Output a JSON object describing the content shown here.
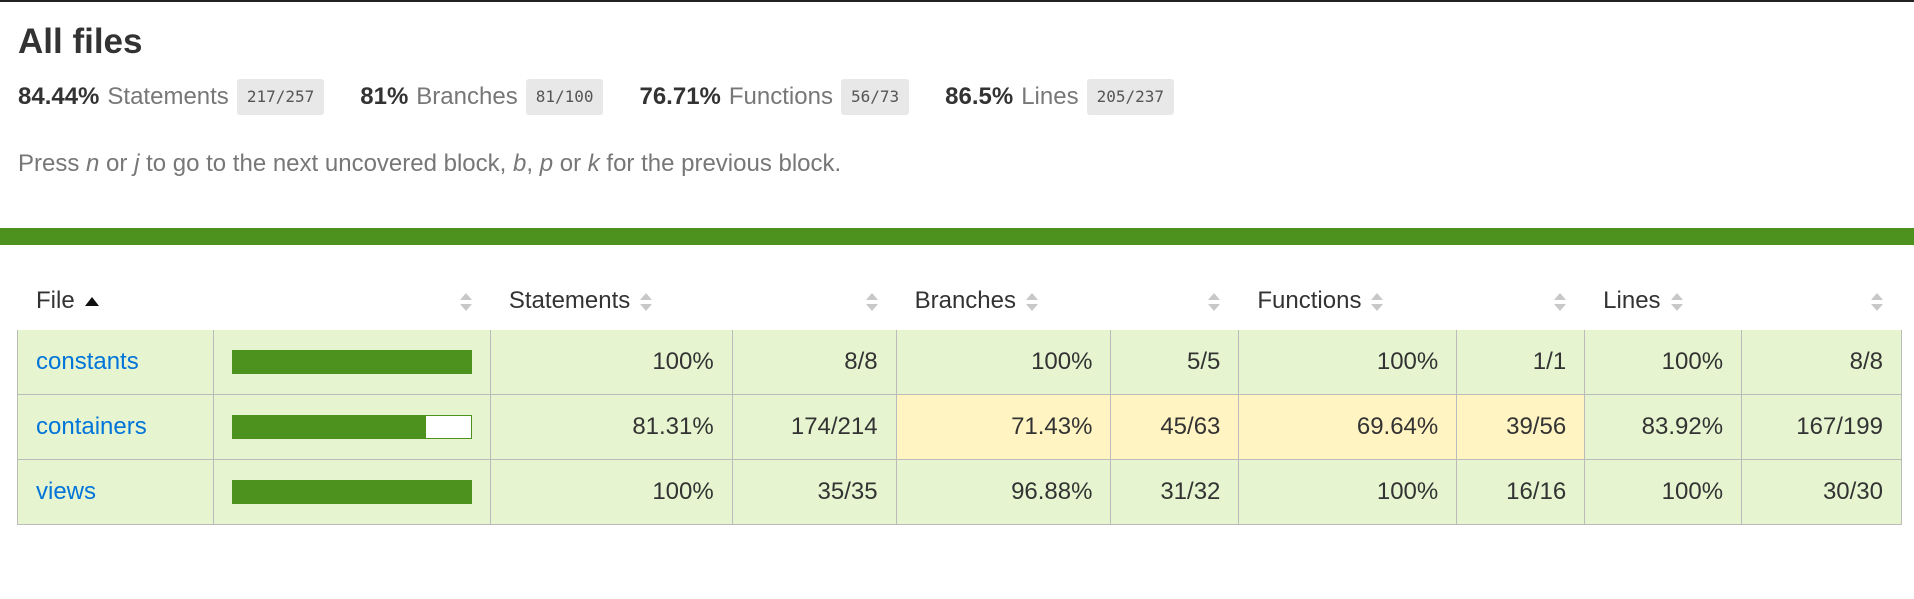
{
  "title": "All files",
  "summary": [
    {
      "pct": "84.44%",
      "label": "Statements",
      "frac": "217/257"
    },
    {
      "pct": "81%",
      "label": "Branches",
      "frac": "81/100"
    },
    {
      "pct": "76.71%",
      "label": "Functions",
      "frac": "56/73"
    },
    {
      "pct": "86.5%",
      "label": "Lines",
      "frac": "205/237"
    }
  ],
  "help": {
    "t1": "Press ",
    "k1": "n",
    "t2": " or ",
    "k2": "j",
    "t3": " to go to the next uncovered block, ",
    "k3": "b",
    "t4": ", ",
    "k4": "p",
    "t5": " or ",
    "k5": "k",
    "t6": " for the previous block."
  },
  "colors": {
    "status_high": "#4d921e",
    "cell_high": "#e6f5d0",
    "cell_medium": "#fff4c2",
    "link": "#0074d9"
  },
  "table": {
    "headers": {
      "file": "File",
      "statements": "Statements",
      "branches": "Branches",
      "functions": "Functions",
      "lines": "Lines"
    },
    "rows": [
      {
        "file": "constants",
        "coverage": 1.0,
        "statements": {
          "pct": "100%",
          "frac": "8/8",
          "level": "high"
        },
        "branches": {
          "pct": "100%",
          "frac": "5/5",
          "level": "high"
        },
        "functions": {
          "pct": "100%",
          "frac": "1/1",
          "level": "high"
        },
        "lines": {
          "pct": "100%",
          "frac": "8/8",
          "level": "high"
        }
      },
      {
        "file": "containers",
        "coverage": 0.8131,
        "statements": {
          "pct": "81.31%",
          "frac": "174/214",
          "level": "high"
        },
        "branches": {
          "pct": "71.43%",
          "frac": "45/63",
          "level": "medium"
        },
        "functions": {
          "pct": "69.64%",
          "frac": "39/56",
          "level": "medium"
        },
        "lines": {
          "pct": "83.92%",
          "frac": "167/199",
          "level": "high"
        }
      },
      {
        "file": "views",
        "coverage": 1.0,
        "statements": {
          "pct": "100%",
          "frac": "35/35",
          "level": "high"
        },
        "branches": {
          "pct": "96.88%",
          "frac": "31/32",
          "level": "high"
        },
        "functions": {
          "pct": "100%",
          "frac": "16/16",
          "level": "high"
        },
        "lines": {
          "pct": "100%",
          "frac": "30/30",
          "level": "high"
        }
      }
    ]
  }
}
